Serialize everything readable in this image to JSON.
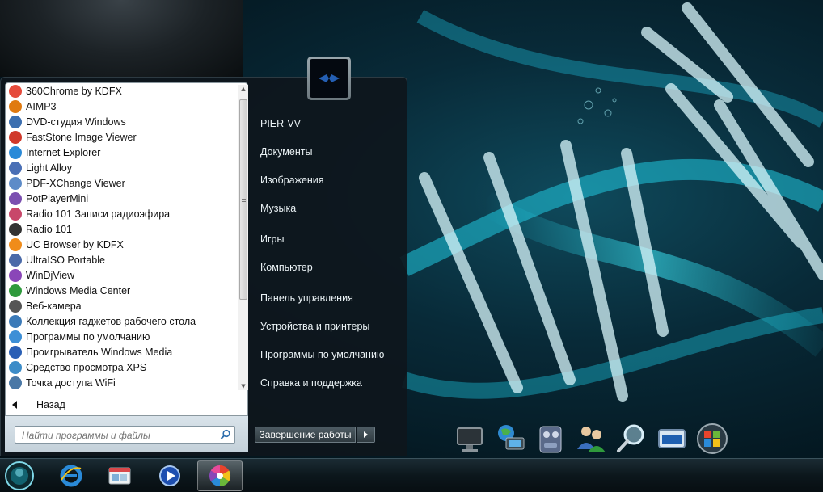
{
  "start_menu": {
    "programs": [
      {
        "label": "360Chrome by KDFX",
        "icon": "chrome-360-icon",
        "color": "#e54b3c"
      },
      {
        "label": "AIMP3",
        "icon": "aimp-icon",
        "color": "#e07a10"
      },
      {
        "label": "DVD-студия Windows",
        "icon": "dvd-studio-icon",
        "color": "#3c6fb0"
      },
      {
        "label": "FastStone Image Viewer",
        "icon": "faststone-icon",
        "color": "#d0392b"
      },
      {
        "label": "Internet Explorer",
        "icon": "internet-explorer-icon",
        "color": "#2a8ad8"
      },
      {
        "label": "Light Alloy",
        "icon": "light-alloy-icon",
        "color": "#4a6fb5"
      },
      {
        "label": "PDF-XChange Viewer",
        "icon": "pdf-xchange-icon",
        "color": "#5d8bc8"
      },
      {
        "label": "PotPlayerMini",
        "icon": "potplayer-icon",
        "color": "#7b4fb0"
      },
      {
        "label": "Radio 101 Записи радиоэфира",
        "icon": "radio101-records-icon",
        "color": "#c8476a"
      },
      {
        "label": "Radio 101",
        "icon": "headphones-icon",
        "color": "#333333"
      },
      {
        "label": "UC Browser by KDFX",
        "icon": "uc-browser-icon",
        "color": "#f08c1a"
      },
      {
        "label": "UltraISO Portable",
        "icon": "ultraiso-icon",
        "color": "#4b6aa8"
      },
      {
        "label": "WinDjView",
        "icon": "windjview-icon",
        "color": "#8a46b8"
      },
      {
        "label": "Windows Media Center",
        "icon": "media-center-icon",
        "color": "#2f9a3c"
      },
      {
        "label": "Веб-камера",
        "icon": "webcam-icon",
        "color": "#555555"
      },
      {
        "label": "Коллекция гаджетов рабочего стола",
        "icon": "gadgets-icon",
        "color": "#3b7ab8"
      },
      {
        "label": "Программы по умолчанию",
        "icon": "default-programs-icon",
        "color": "#3d8fd6"
      },
      {
        "label": "Проигрыватель Windows Media",
        "icon": "windows-media-player-icon",
        "color": "#2a5fb5"
      },
      {
        "label": "Средство просмотра XPS",
        "icon": "xps-viewer-icon",
        "color": "#3c8cc8"
      },
      {
        "label": "Точка доступа WiFi",
        "icon": "wifi-hotspot-icon",
        "color": "#4a78a6"
      }
    ],
    "back_label": "Назад",
    "search_placeholder": "Найти программы и файлы",
    "right_pane": {
      "user": "PIER-VV",
      "documents": "Документы",
      "pictures": "Изображения",
      "music": "Музыка",
      "games": "Игры",
      "computer": "Компьютер",
      "control_panel": "Панель управления",
      "devices": "Устройства и принтеры",
      "default_programs": "Программы по умолчанию",
      "help": "Справка и поддержка"
    },
    "shutdown_label": "Завершение работы"
  },
  "dock": [
    {
      "icon": "monitor-icon"
    },
    {
      "icon": "network-globe-icon"
    },
    {
      "icon": "control-panel-icon"
    },
    {
      "icon": "users-icon"
    },
    {
      "icon": "magnifier-icon"
    },
    {
      "icon": "window-icon"
    },
    {
      "icon": "windows-logo-icon"
    }
  ],
  "taskbar": {
    "items": [
      {
        "icon": "internet-explorer-icon",
        "active": false
      },
      {
        "icon": "explorer-window-icon",
        "active": false
      },
      {
        "icon": "media-player-icon",
        "active": false
      },
      {
        "icon": "chrome-360-icon",
        "active": true
      }
    ]
  }
}
